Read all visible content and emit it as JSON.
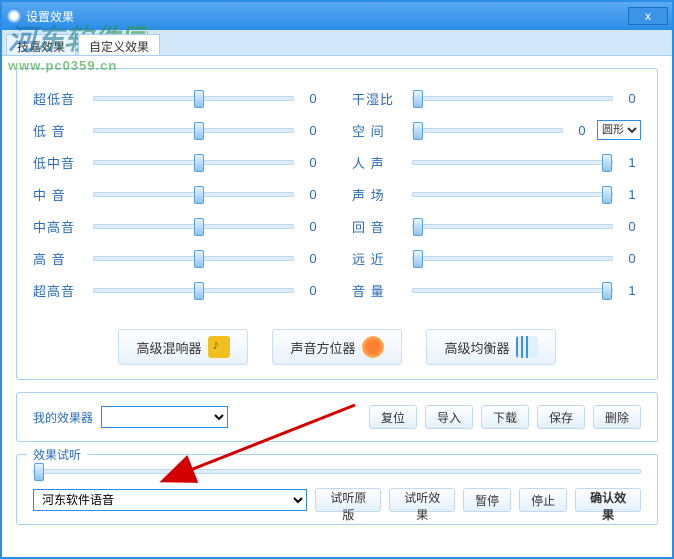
{
  "window": {
    "title": "设置效果"
  },
  "tabs": {
    "t0": "技嘉效果",
    "t1": "自定义效果"
  },
  "eq_left": [
    {
      "label": "超低音",
      "value": "0"
    },
    {
      "label": "低 音",
      "value": "0"
    },
    {
      "label": "低中音",
      "value": "0"
    },
    {
      "label": "中 音",
      "value": "0"
    },
    {
      "label": "中高音",
      "value": "0"
    },
    {
      "label": "高 音",
      "value": "0"
    },
    {
      "label": "超高音",
      "value": "0"
    }
  ],
  "eq_right": [
    {
      "label": "干湿比",
      "value": "0"
    },
    {
      "label": "空 间",
      "value": "0",
      "select": "圆形"
    },
    {
      "label": "人 声",
      "value": "1"
    },
    {
      "label": "声 场",
      "value": "1"
    },
    {
      "label": "回 音",
      "value": "0"
    },
    {
      "label": "远 近",
      "value": "0"
    },
    {
      "label": "音 量",
      "value": "1"
    }
  ],
  "buttons": {
    "mixer": "高级混响器",
    "locator": "声音方位器",
    "equalizer": "高级均衡器",
    "preset_label": "我的效果器",
    "reset": "复位",
    "import": "导入",
    "download": "下载",
    "save": "保存",
    "delete": "删除"
  },
  "preview": {
    "title": "效果试听",
    "select": "河东软件语音",
    "orig": "试听原版",
    "effect": "试听效果",
    "pause": "暂停",
    "stop": "停止",
    "confirm": "确认效果"
  },
  "watermark": {
    "top": "河东软件园",
    "url": "www.pc0359.cn"
  }
}
